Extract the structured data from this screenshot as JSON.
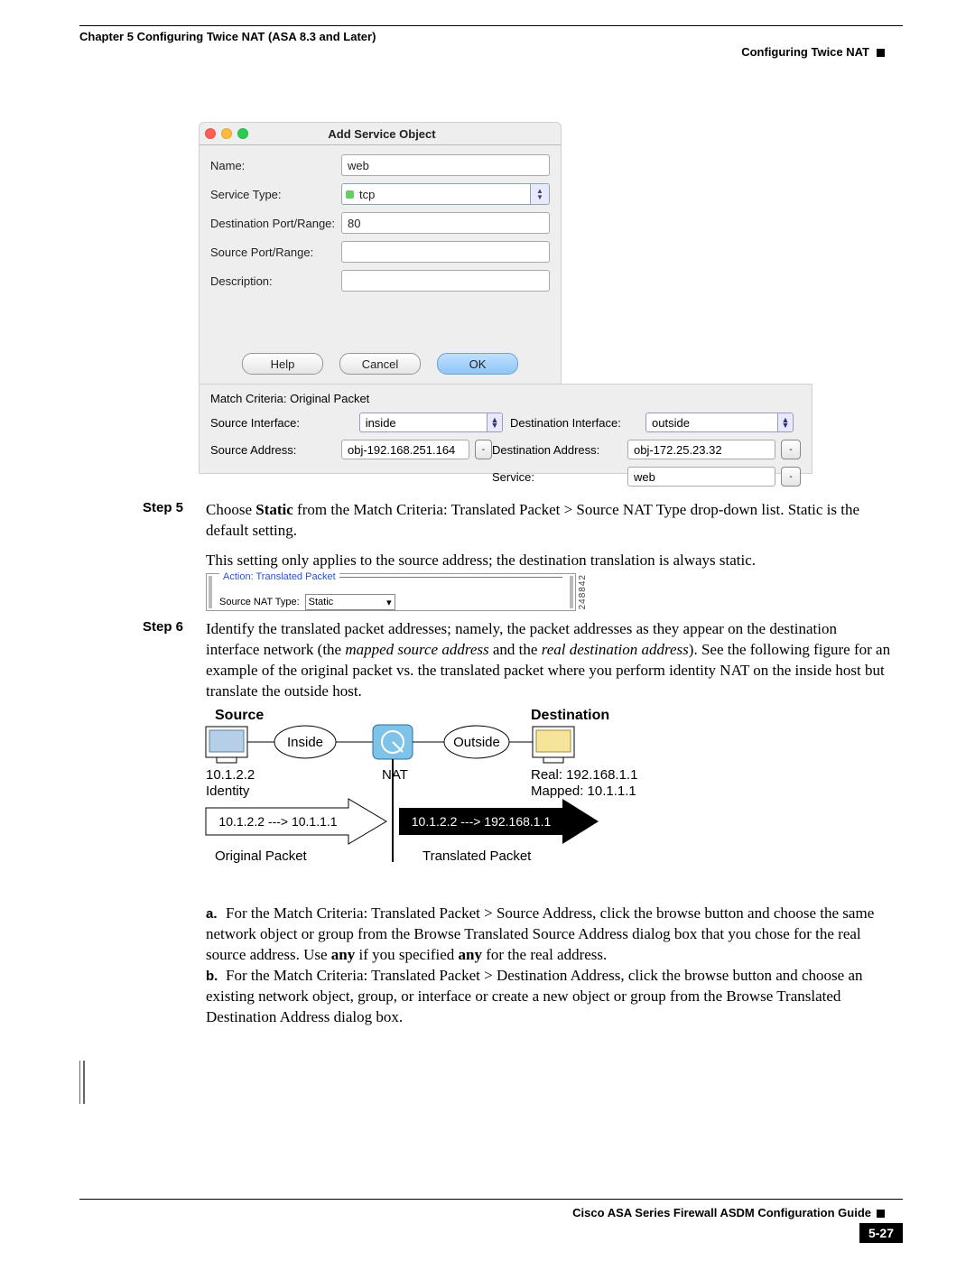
{
  "header": {
    "chapter": "Chapter 5    Configuring Twice NAT (ASA 8.3 and Later)",
    "section": "Configuring Twice NAT"
  },
  "dialog": {
    "title": "Add Service Object",
    "name_label": "Name:",
    "name_value": "web",
    "svc_label": "Service Type:",
    "svc_value": "tcp",
    "dport_label": "Destination Port/Range:",
    "dport_value": "80",
    "sport_label": "Source Port/Range:",
    "sport_value": "",
    "desc_label": "Description:",
    "desc_value": "",
    "help": "Help",
    "cancel": "Cancel",
    "ok": "OK"
  },
  "match": {
    "title": "Match Criteria: Original Packet",
    "src_if_label": "Source Interface:",
    "src_if": "inside",
    "dst_if_label": "Destination Interface:",
    "dst_if": "outside",
    "src_addr_label": "Source Address:",
    "src_addr": "obj-192.168.251.164",
    "dst_addr_label": "Destination Address:",
    "dst_addr": "obj-172.25.23.32",
    "svc_label": "Service:",
    "svc": "web"
  },
  "step5": {
    "num": "Step 5",
    "p1a": "Choose ",
    "p1b": "Static",
    "p1c": " from the Match Criteria: Translated Packet > Source NAT Type drop-down list. Static is the default setting.",
    "p2": "This setting only applies to the source address; the destination translation is always static."
  },
  "mini": {
    "legend": "Action: Translated Packet",
    "row_label": "Source NAT Type:",
    "row_value": "Static",
    "idnum": "248842"
  },
  "step6": {
    "num": "Step 6",
    "p1a": "Identify the translated packet addresses; namely, the packet addresses as they appear on the destination interface network (the ",
    "p1b": "mapped source address",
    "p1c": " and the ",
    "p1d": "real destination address",
    "p1e": "). See the following figure for an example of the original packet vs. the translated packet where you perform identity NAT on the inside host but translate the outside host."
  },
  "diagram": {
    "source": "Source",
    "destination": "Destination",
    "inside": "Inside",
    "outside": "Outside",
    "nat": "NAT",
    "src_ip": "10.1.2.2",
    "src_note": "Identity",
    "dst_real": "Real: 192.168.1.1",
    "dst_mapped": "Mapped: 10.1.1.1",
    "orig_flow": "10.1.2.2 ---> 10.1.1.1",
    "trans_flow": "10.1.2.2 ---> 192.168.1.1",
    "orig_label": "Original Packet",
    "trans_label": "Translated Packet"
  },
  "sub": {
    "a_lt": "a.",
    "a": "For the Match Criteria: Translated Packet > Source Address, click the browse button and choose the same network object or group from the Browse Translated Source Address dialog box that you chose for the real source address. Use ",
    "a_b1": "any",
    "a_mid": " if you specified ",
    "a_b2": "any",
    "a_end": " for the real address.",
    "b_lt": "b.",
    "b": "For the Match Criteria: Translated Packet > Destination Address, click the browse button and choose an existing network object, group, or interface or create a new object or group from the Browse Translated Destination Address dialog box."
  },
  "footer": {
    "title": "Cisco ASA Series Firewall ASDM Configuration Guide",
    "page": "5-27"
  }
}
